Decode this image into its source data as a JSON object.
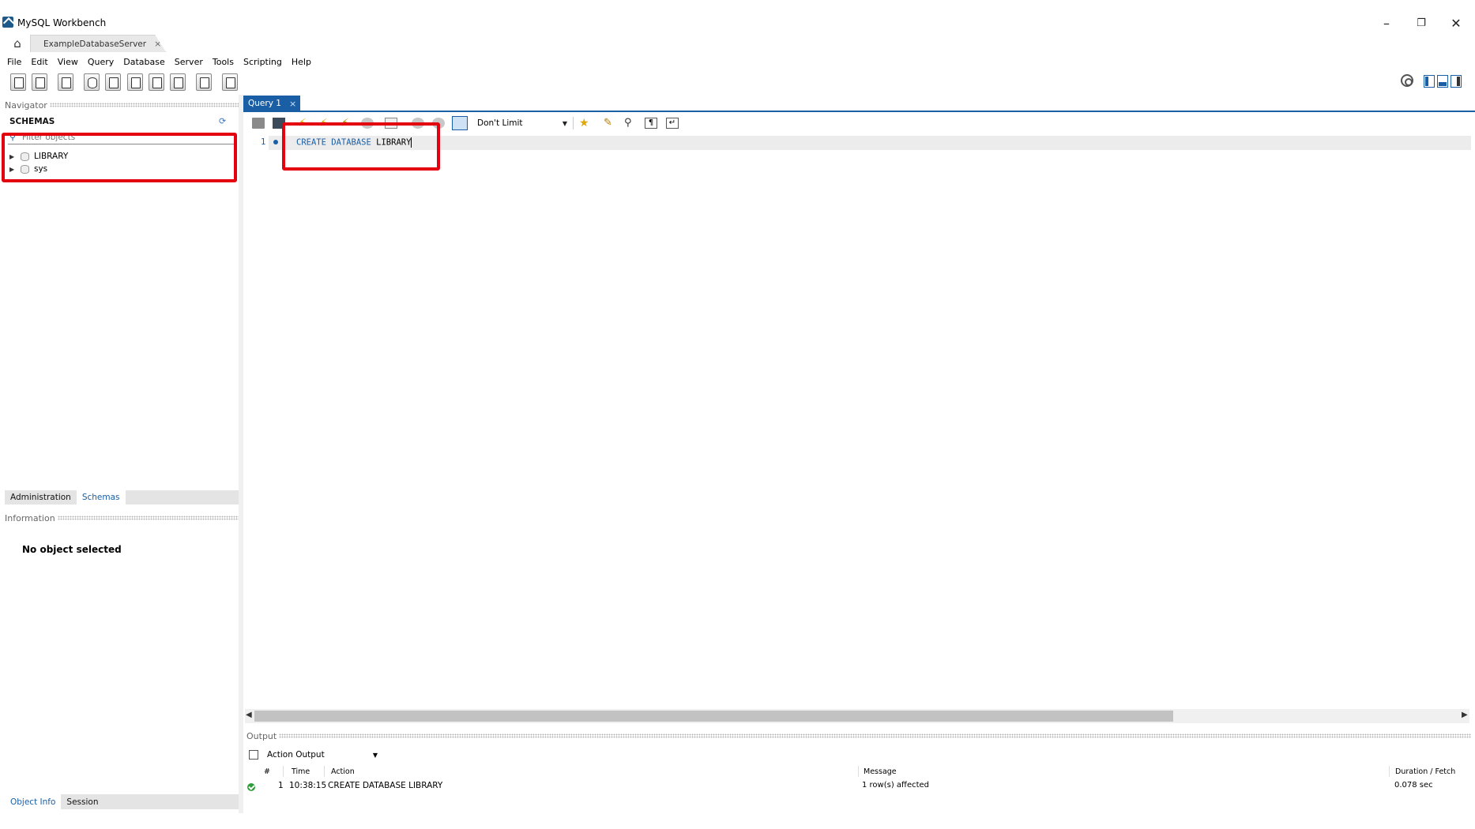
{
  "window": {
    "title": "MySQL Workbench",
    "controls": {
      "minimize": "–",
      "restore": "❐",
      "close": "✕"
    }
  },
  "connection_tab": {
    "label": "ExampleDatabaseServer",
    "close": "×"
  },
  "menu": [
    "File",
    "Edit",
    "View",
    "Query",
    "Database",
    "Server",
    "Tools",
    "Scripting",
    "Help"
  ],
  "navigator": {
    "header": "Navigator",
    "schemas_title": "SCHEMAS",
    "filter_placeholder": "Filter objects",
    "schemas": [
      "LIBRARY",
      "sys"
    ],
    "tabs": [
      "Administration",
      "Schemas"
    ],
    "active_tab": "Schemas",
    "information_header": "Information",
    "no_object": "No object selected",
    "bottom_tabs": [
      "Object Info",
      "Session"
    ],
    "active_bottom_tab": "Object Info"
  },
  "query": {
    "tab_label": "Query 1",
    "tab_close": "×",
    "limit": "Don't Limit",
    "line_number": "1",
    "code_keywords": "CREATE DATABASE",
    "code_identifier": "LIBRARY"
  },
  "output": {
    "header": "Output",
    "selector": "Action Output",
    "columns": [
      "#",
      "Time",
      "Action",
      "Message",
      "Duration / Fetch"
    ],
    "rows": [
      {
        "num": "1",
        "time": "10:38:15",
        "action": "CREATE DATABASE LIBRARY",
        "message": "1 row(s) affected",
        "duration": "0.078 sec",
        "status": "success"
      }
    ]
  },
  "colors": {
    "accent": "#1a5ea6",
    "highlight_box": "#e4000f",
    "success": "#2e9d3a"
  }
}
